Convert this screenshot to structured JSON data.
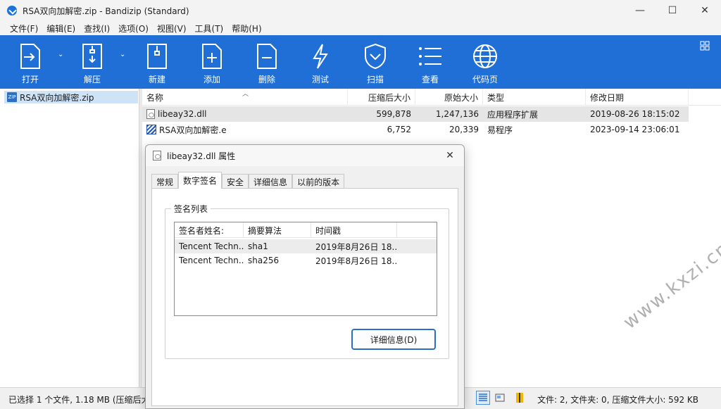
{
  "window": {
    "title": "RSA双向加解密.zip - Bandizip (Standard)",
    "minimize": "—",
    "maximize": "☐",
    "close": "✕"
  },
  "menu": [
    "文件(F)",
    "编辑(E)",
    "查找(I)",
    "选项(O)",
    "视图(V)",
    "工具(T)",
    "帮助(H)"
  ],
  "toolbar": {
    "open": "打开",
    "extract": "解压",
    "new": "新建",
    "add": "添加",
    "delete": "删除",
    "test": "测试",
    "scan": "扫描",
    "view": "查看",
    "codepage": "代码页"
  },
  "tree": {
    "item": "RSA双向加解密.zip"
  },
  "columns": {
    "name": "名称",
    "compressed": "压缩后大小",
    "original": "原始大小",
    "type": "类型",
    "modified": "修改日期"
  },
  "files": [
    {
      "name": "libeay32.dll",
      "compressed": "599,878",
      "original": "1,247,136",
      "type": "应用程序扩展",
      "modified": "2019-08-26 18:15:02"
    },
    {
      "name": "RSA双向加解密.e",
      "compressed": "6,752",
      "original": "20,339",
      "type": "易程序",
      "modified": "2023-09-14 23:06:01"
    }
  ],
  "status": {
    "left": "已选择 1 个文件, 1.18 MB (压缩后大",
    "right": "文件: 2, 文件夹: 0, 压缩文件大小: 592 KB"
  },
  "dialog": {
    "title": "libeay32.dll 属性",
    "close": "✕",
    "tabs": [
      "常规",
      "数字签名",
      "安全",
      "详细信息",
      "以前的版本"
    ],
    "group_label": "签名列表",
    "list_headers": {
      "signer": "签名者姓名:",
      "digest": "摘要算法",
      "timestamp": "时间戳"
    },
    "signatures": [
      {
        "signer": "Tencent Techn...",
        "digest": "sha1",
        "timestamp": "2019年8月26日 18..."
      },
      {
        "signer": "Tencent Techn...",
        "digest": "sha256",
        "timestamp": "2019年8月26日 18..."
      }
    ],
    "details_button": "详细信息(D)"
  },
  "watermark": "www.kxzi.cn",
  "colors": {
    "toolbar_bg": "#1f6fd6",
    "selection": "#cfe3f7",
    "button_border": "#2b6ec9"
  }
}
